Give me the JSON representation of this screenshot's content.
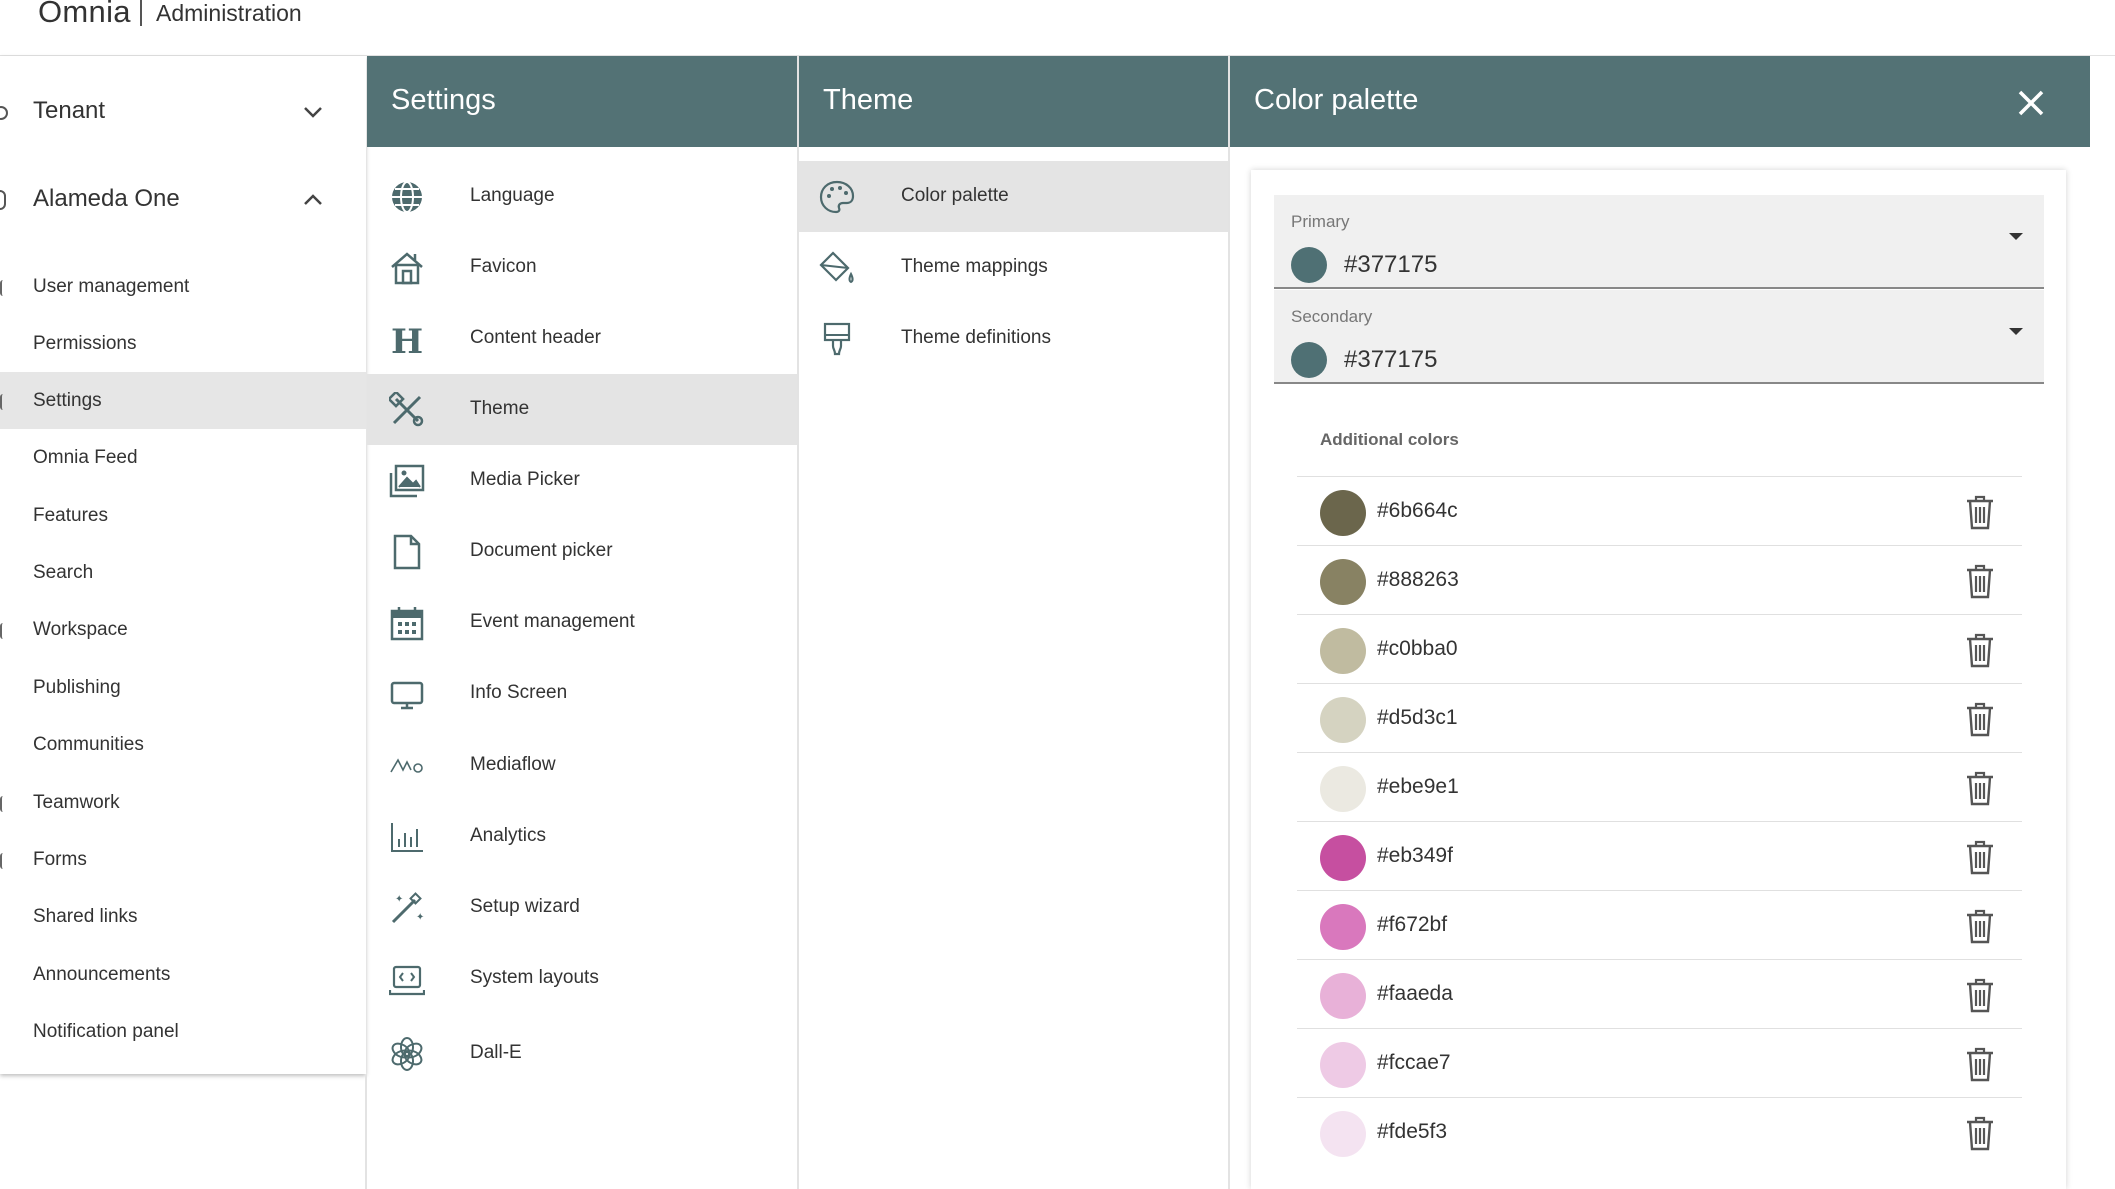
{
  "header": {
    "brand": "Omnia",
    "section": "Administration"
  },
  "leftnav": {
    "groups": [
      {
        "label": "Tenant",
        "expanded": false
      },
      {
        "label": "Alameda One",
        "expanded": true
      }
    ],
    "items": [
      {
        "label": "User management"
      },
      {
        "label": "Permissions"
      },
      {
        "label": "Settings",
        "active": true
      },
      {
        "label": "Omnia Feed"
      },
      {
        "label": "Features"
      },
      {
        "label": "Search"
      },
      {
        "label": "Workspace"
      },
      {
        "label": "Publishing"
      },
      {
        "label": "Communities"
      },
      {
        "label": "Teamwork"
      },
      {
        "label": "Forms"
      },
      {
        "label": "Shared links"
      },
      {
        "label": "Announcements"
      },
      {
        "label": "Notification panel"
      }
    ]
  },
  "settings": {
    "title": "Settings",
    "items": [
      {
        "label": "Language",
        "icon": "globe-icon"
      },
      {
        "label": "Favicon",
        "icon": "home-icon"
      },
      {
        "label": "Content header",
        "icon": "heading-icon"
      },
      {
        "label": "Theme",
        "icon": "theme-tools-icon",
        "active": true
      },
      {
        "label": "Media Picker",
        "icon": "images-icon"
      },
      {
        "label": "Document picker",
        "icon": "document-icon"
      },
      {
        "label": "Event management",
        "icon": "calendar-icon"
      },
      {
        "label": "Info Screen",
        "icon": "monitor-icon"
      },
      {
        "label": "Mediaflow",
        "icon": "mediaflow-icon"
      },
      {
        "label": "Analytics",
        "icon": "bar-chart-icon"
      },
      {
        "label": "Setup wizard",
        "icon": "magic-wand-icon"
      },
      {
        "label": "System layouts",
        "icon": "laptop-code-icon"
      },
      {
        "label": "Dall-E",
        "icon": "openai-icon"
      }
    ]
  },
  "theme": {
    "title": "Theme",
    "items": [
      {
        "label": "Color palette",
        "icon": "palette-icon",
        "active": true
      },
      {
        "label": "Theme mappings",
        "icon": "paint-bucket-icon"
      },
      {
        "label": "Theme definitions",
        "icon": "brush-icon"
      }
    ]
  },
  "palette": {
    "title": "Color palette",
    "primary": {
      "label": "Primary",
      "value": "#377175",
      "color": "#4f7074"
    },
    "secondary": {
      "label": "Secondary",
      "value": "#377175",
      "color": "#4f7074"
    },
    "additional_title": "Additional colors",
    "additional": [
      {
        "hex": "#6b664c",
        "color": "#6b664c"
      },
      {
        "hex": "#888263",
        "color": "#888263"
      },
      {
        "hex": "#c0bba0",
        "color": "#c0bba0"
      },
      {
        "hex": "#d5d3c1",
        "color": "#d5d3c1"
      },
      {
        "hex": "#ebe9e1",
        "color": "#ebe9e1"
      },
      {
        "hex": "#eb349f",
        "color": "#c64fa0"
      },
      {
        "hex": "#f672bf",
        "color": "#d978bd"
      },
      {
        "hex": "#faaeda",
        "color": "#e8b1d8"
      },
      {
        "hex": "#fccae7",
        "color": "#eecae5"
      },
      {
        "hex": "#fde5f3",
        "color": "#f4e3f1"
      }
    ]
  },
  "colors": {
    "header_bg": "#537275",
    "accent": "#377175",
    "icon": "#4d6a6d"
  }
}
